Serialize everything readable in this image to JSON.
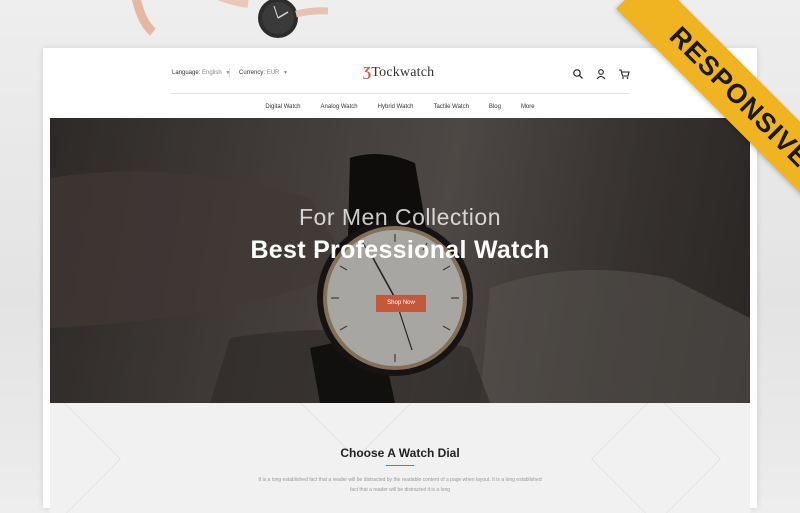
{
  "header": {
    "language_label": "Language:",
    "language_value": "English",
    "currency_label": "Currency:",
    "currency_value": "EUR",
    "logo_mark": "Ʒ",
    "logo_text": "Tockwatch",
    "icons": [
      "search-icon",
      "user-icon",
      "cart-icon"
    ]
  },
  "nav": {
    "items": [
      "Digital Watch",
      "Analog Watch",
      "Hybrid Watch",
      "Tactile Watch",
      "Blog",
      "More"
    ]
  },
  "hero": {
    "subtitle": "For Men Collection",
    "title": "Best Professional Watch",
    "button_label": "Shop Now"
  },
  "section": {
    "title": "Choose A Watch Dial",
    "description": "It is a long established fact that a reader will be distracted by the readable content of a page when layout. It is a long established fact that a reader will be distracted it is a long"
  },
  "ribbon": {
    "label": "RESPONSIVE",
    "color": "#f0b321"
  },
  "colors": {
    "accent": "#c5573a",
    "ribbon": "#f0b321"
  }
}
